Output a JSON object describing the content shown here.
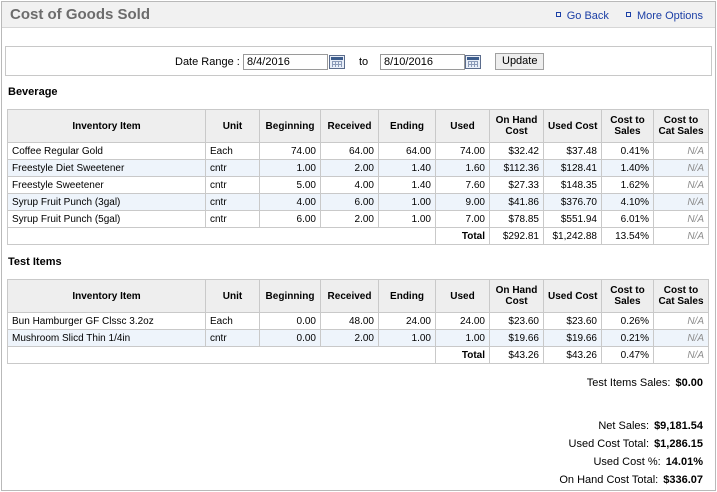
{
  "page": {
    "title": "Cost of Goods Sold",
    "links": {
      "go_back": "Go Back",
      "more_options": "More Options"
    }
  },
  "date_range": {
    "label": "Date Range :",
    "from_value": "8/4/2016",
    "to_label": "to",
    "to_value": "8/10/2016",
    "update_label": "Update"
  },
  "columns": [
    "Inventory Item",
    "Unit",
    "Beginning",
    "Received",
    "Ending",
    "Used",
    "On Hand Cost",
    "Used Cost",
    "Cost to Sales",
    "Cost to Cat Sales"
  ],
  "sections": [
    {
      "name": "Beverage",
      "rows": [
        [
          "Coffee Regular Gold",
          "Each",
          "74.00",
          "64.00",
          "64.00",
          "74.00",
          "$32.42",
          "$37.48",
          "0.41%",
          "N/A"
        ],
        [
          "Freestyle Diet Sweetener",
          "cntr",
          "1.00",
          "2.00",
          "1.40",
          "1.60",
          "$112.36",
          "$128.41",
          "1.40%",
          "N/A"
        ],
        [
          "Freestyle Sweetener",
          "cntr",
          "5.00",
          "4.00",
          "1.40",
          "7.60",
          "$27.33",
          "$148.35",
          "1.62%",
          "N/A"
        ],
        [
          "Syrup Fruit Punch (3gal)",
          "cntr",
          "4.00",
          "6.00",
          "1.00",
          "9.00",
          "$41.86",
          "$376.70",
          "4.10%",
          "N/A"
        ],
        [
          "Syrup Fruit Punch (5gal)",
          "cntr",
          "6.00",
          "2.00",
          "1.00",
          "7.00",
          "$78.85",
          "$551.94",
          "6.01%",
          "N/A"
        ]
      ],
      "total": {
        "label": "Total",
        "on_hand": "$292.81",
        "used": "$1,242.88",
        "cost_to_sales": "13.54%",
        "cat": "N/A"
      }
    },
    {
      "name": "Test Items",
      "rows": [
        [
          "Bun Hamburger GF Clssc 3.2oz",
          "Each",
          "0.00",
          "48.00",
          "24.00",
          "24.00",
          "$23.60",
          "$23.60",
          "0.26%",
          "N/A"
        ],
        [
          "Mushroom Slicd Thin 1/4in",
          "cntr",
          "0.00",
          "2.00",
          "1.00",
          "1.00",
          "$19.66",
          "$19.66",
          "0.21%",
          "N/A"
        ]
      ],
      "total": {
        "label": "Total",
        "on_hand": "$43.26",
        "used": "$43.26",
        "cost_to_sales": "0.47%",
        "cat": "N/A"
      }
    }
  ],
  "test_items_sales": {
    "label": "Test Items Sales:",
    "value": "$0.00"
  },
  "summary": [
    {
      "label": "Net Sales:",
      "value": "$9,181.54"
    },
    {
      "label": "Used Cost Total:",
      "value": "$1,286.15"
    },
    {
      "label": "Used Cost %:",
      "value": "14.01%"
    },
    {
      "label": "On Hand Cost Total:",
      "value": "$336.07"
    }
  ],
  "colors": {
    "link": "#1b3fa6",
    "alt_row": "#eef4fb",
    "header_bg": "#eeeeee",
    "title": "#6c6c6c"
  }
}
